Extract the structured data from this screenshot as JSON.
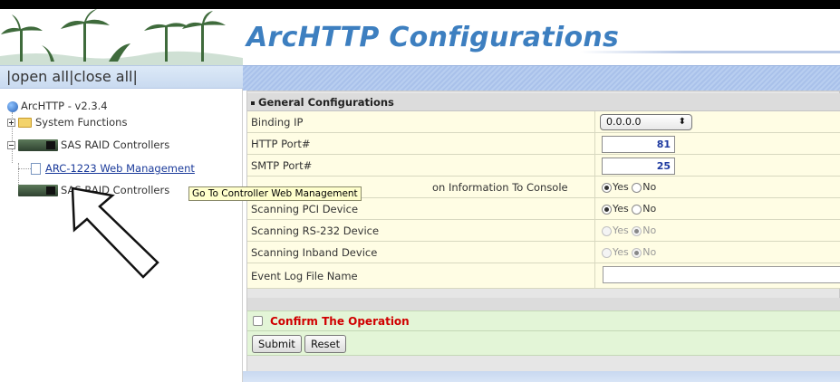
{
  "header": {
    "title": "ArcHTTP Configurations"
  },
  "menu": {
    "open_all": "open all",
    "close_all": "close all"
  },
  "tree": {
    "root": "ArcHTTP - v2.3.4",
    "system_functions": "System Functions",
    "sas_raid_1": "SAS RAID Controllers",
    "web_management": "ARC-1223 Web Management",
    "sas_raid_2": "SAS RAID Controllers"
  },
  "tooltip": "Go To Controller Web Management",
  "config": {
    "section_title": "General Configurations",
    "rows": [
      {
        "label": "Binding IP",
        "value": "0.0.0.0"
      },
      {
        "label": "HTTP Port#",
        "value": "81"
      },
      {
        "label": "SMTP Port#",
        "value": "25"
      },
      {
        "label": "on Information To Console",
        "yes": "Yes",
        "no": "No"
      },
      {
        "label": "Scanning PCI Device",
        "yes": "Yes",
        "no": "No"
      },
      {
        "label": "Scanning RS-232 Device",
        "yes": "Yes",
        "no": "No"
      },
      {
        "label": "Scanning Inband Device",
        "yes": "Yes",
        "no": "No"
      },
      {
        "label": "Event Log File Name",
        "value": ""
      }
    ]
  },
  "confirm_label": "Confirm The Operation",
  "buttons": {
    "submit": "Submit",
    "reset": "Reset"
  },
  "colors": {
    "title_blue": "#3d7fc0",
    "confirm_red": "#d00000",
    "row_yellow": "#fffde4",
    "action_green": "#e3f5d7"
  }
}
